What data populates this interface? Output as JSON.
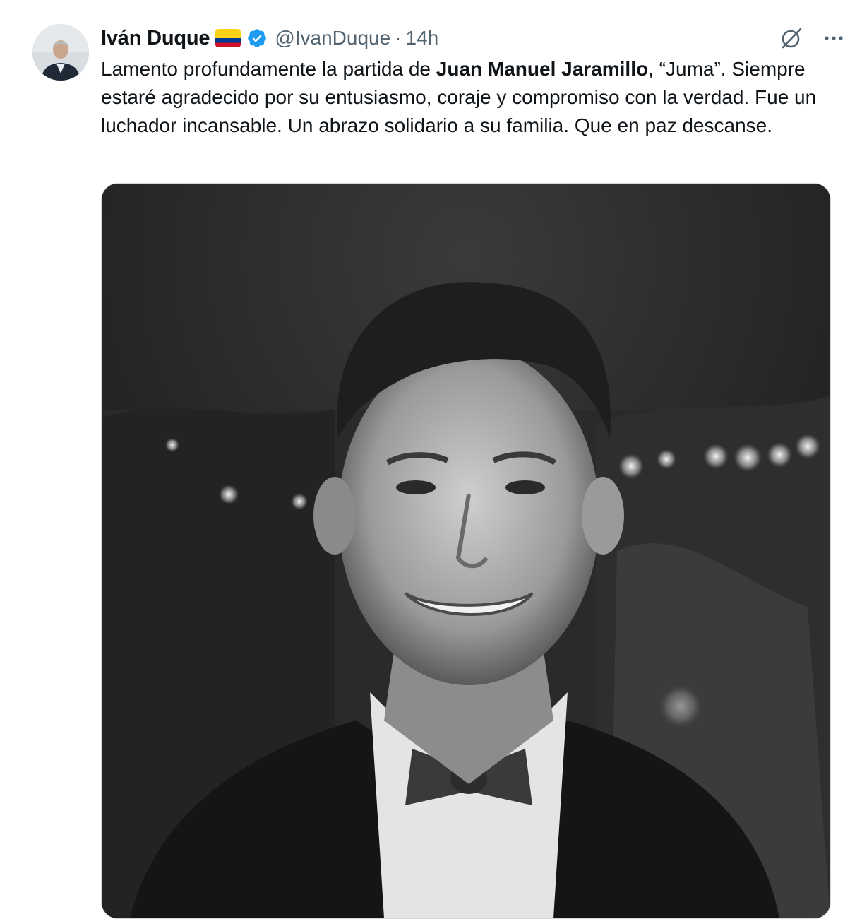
{
  "author": {
    "name": "Iván Duque",
    "handle": "@IvanDuque",
    "separator": "·",
    "time": "14h",
    "flag_icon": "colombia-flag-icon",
    "verified_icon": "verified-badge-icon"
  },
  "tweet": {
    "text_before": "Lamento profundamente la partida de ",
    "text_bold": "Juan Manuel Jaramillo",
    "text_after": ", “Juma”. Siempre estaré agradecido por su entusiasmo, coraje y compromiso con la verdad. Fue  un luchador incansable. Un abrazo solidario a su familia. Que en paz descanse."
  },
  "actions": {
    "grok_icon": "grok-icon",
    "more_icon": "more-icon"
  },
  "colors": {
    "text": "#0f1419",
    "secondary": "#536471",
    "verified": "#1d9bf0",
    "border": "#cfd9de"
  },
  "media": {
    "description_icon": "photo"
  }
}
